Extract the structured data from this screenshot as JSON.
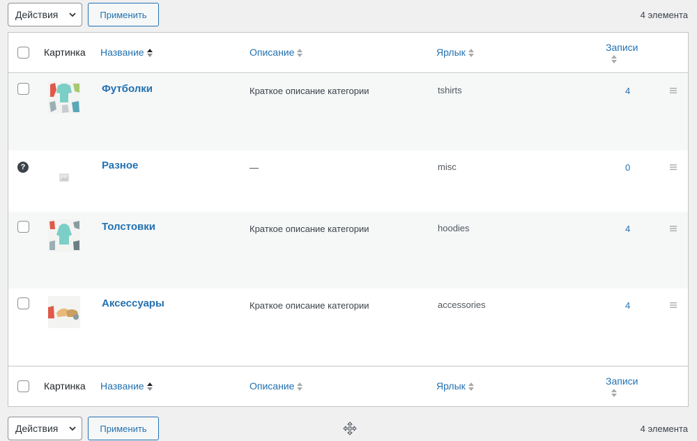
{
  "toolbar_top": {
    "actions_label": "Действия",
    "apply_label": "Применить",
    "count": "4 элемента"
  },
  "toolbar_bottom": {
    "actions_label": "Действия",
    "apply_label": "Применить",
    "count": "4 элемента"
  },
  "columns": {
    "image": "Картинка",
    "name": "Название",
    "description": "Описание",
    "slug": "Ярлык",
    "count": "Записи"
  },
  "rows": [
    {
      "name": "Футболки",
      "description": "Краткое описание категории",
      "slug": "tshirts",
      "count": "4",
      "thumb": "tshirts-thumbnail",
      "selectable": true
    },
    {
      "name": "Разное",
      "description": "—",
      "slug": "misc",
      "count": "0",
      "thumb": "placeholder-image",
      "selectable": false
    },
    {
      "name": "Толстовки",
      "description": "Краткое описание категории",
      "slug": "hoodies",
      "count": "4",
      "thumb": "hoodies-thumbnail",
      "selectable": true
    },
    {
      "name": "Аксессуары",
      "description": "Краткое описание категории",
      "slug": "accessories",
      "count": "4",
      "thumb": "accessories-thumbnail",
      "selectable": true
    }
  ],
  "help_icon_glyph": "?",
  "colors": {
    "link": "#2271b1",
    "border": "#c3c4c7",
    "alt_row": "#f6f7f7"
  }
}
